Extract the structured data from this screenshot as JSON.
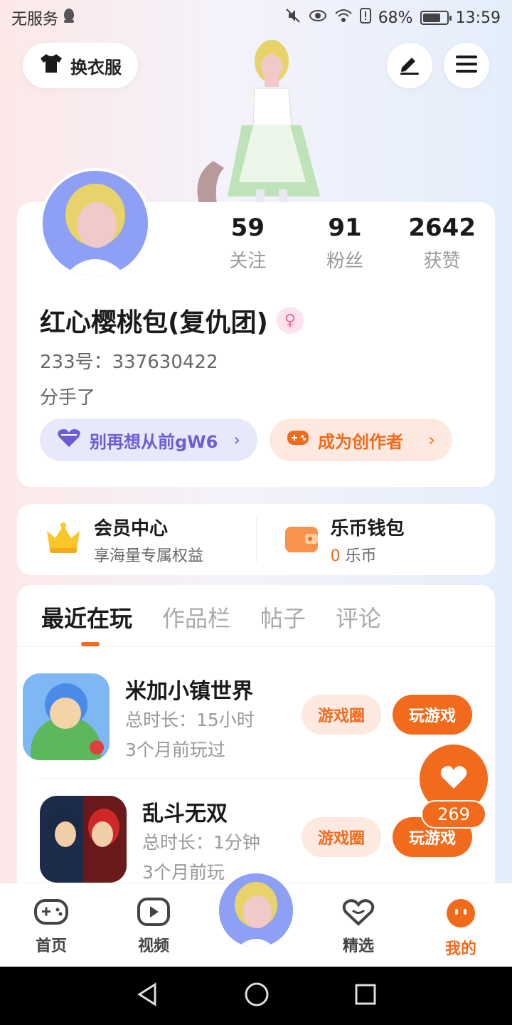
{
  "status": {
    "carrier": "无服务",
    "battery": "68%",
    "time": "13:59"
  },
  "top": {
    "outfit_label": "换衣服"
  },
  "profile": {
    "stats": [
      {
        "num": "59",
        "label": "关注"
      },
      {
        "num": "91",
        "label": "粉丝"
      },
      {
        "num": "2642",
        "label": "获赞"
      }
    ],
    "nickname": "红心樱桃包(复仇团)",
    "uid": "233号：337630422",
    "bio": "分手了",
    "group_pill": "别再想从前gW6",
    "creator_pill": "成为创作者"
  },
  "wallet": {
    "vip_title": "会员中心",
    "vip_sub": "享海量专属权益",
    "coin_title": "乐币钱包",
    "coin_amount": "0",
    "coin_unit": "乐币"
  },
  "tabs": [
    "最近在玩",
    "作品栏",
    "帖子",
    "评论"
  ],
  "games": [
    {
      "name": "米加小镇世界",
      "time": "总时长：15小时",
      "last": "3个月前玩过",
      "circle_btn": "游戏圈",
      "play_btn": "玩游戏"
    },
    {
      "name": "乱斗无双",
      "time": "总时长：1分钟",
      "last": "3个月前玩",
      "circle_btn": "游戏圈",
      "play_btn": "玩游戏"
    }
  ],
  "like_count": "269",
  "nav": [
    "首页",
    "视频",
    "精选",
    "我的"
  ],
  "colors": {
    "accent": "#f26a1c",
    "purple": "#6a5ed6"
  }
}
